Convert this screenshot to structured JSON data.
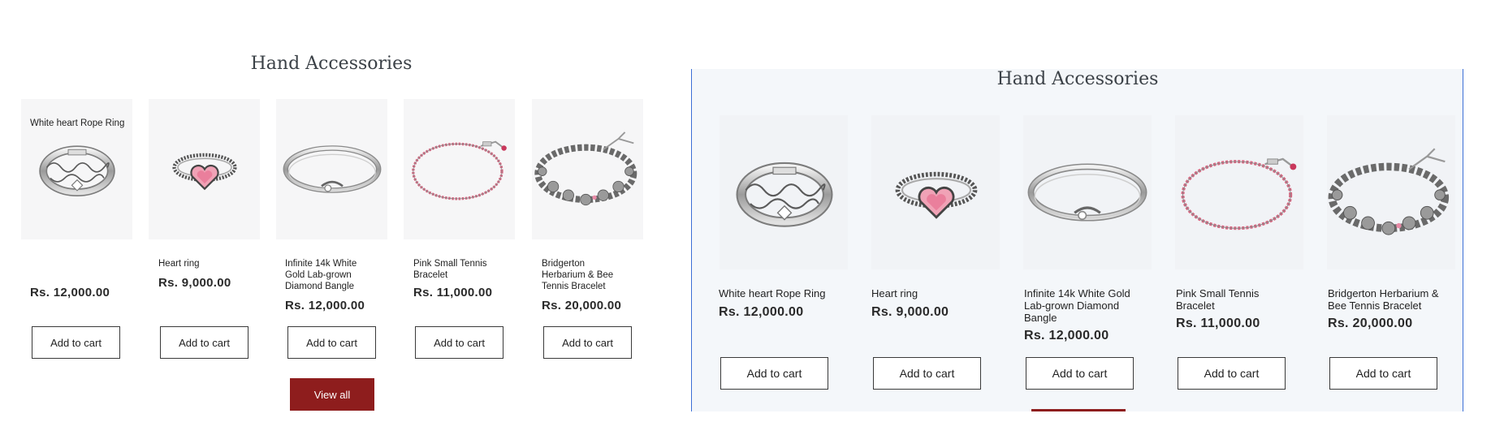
{
  "left": {
    "title": "Hand Accessories",
    "view_all": "View all",
    "products": [
      {
        "name": "White heart Rope Ring",
        "price": "Rs. 12,000.00",
        "cta": "Add to cart"
      },
      {
        "name": "Heart ring",
        "price": "Rs. 9,000.00",
        "cta": "Add to cart"
      },
      {
        "name": "Infinite 14k White Gold Lab-grown Diamond Bangle",
        "price": "Rs. 12,000.00",
        "cta": "Add to cart"
      },
      {
        "name": "Pink Small Tennis Bracelet",
        "price": "Rs. 11,000.00",
        "cta": "Add to cart"
      },
      {
        "name": "Bridgerton Herbarium & Bee Tennis Bracelet",
        "price": "Rs. 20,000.00",
        "cta": "Add to cart"
      }
    ]
  },
  "right": {
    "title": "Hand Accessories",
    "products": [
      {
        "name": "White heart Rope Ring",
        "price": "Rs. 12,000.00",
        "cta": "Add to cart"
      },
      {
        "name": "Heart ring",
        "price": "Rs. 9,000.00",
        "cta": "Add to cart"
      },
      {
        "name": "Infinite 14k White Gold Lab-grown Diamond Bangle",
        "price": "Rs. 12,000.00",
        "cta": "Add to cart"
      },
      {
        "name": "Pink Small Tennis Bracelet",
        "price": "Rs. 11,000.00",
        "cta": "Add to cart"
      },
      {
        "name": "Bridgerton Herbarium & Bee Tennis Bracelet",
        "price": "Rs. 20,000.00",
        "cta": "Add to cart"
      }
    ]
  },
  "colors": {
    "accent": "#8e1d1d",
    "selection_border": "#3b6fd6",
    "panel_bg": "#f4f7fa",
    "heading": "#3b4147"
  },
  "icons": [
    "rope-ring-image",
    "heart-ring-image",
    "bangle-image",
    "tennis-bracelet-image",
    "herbarium-bracelet-image"
  ]
}
